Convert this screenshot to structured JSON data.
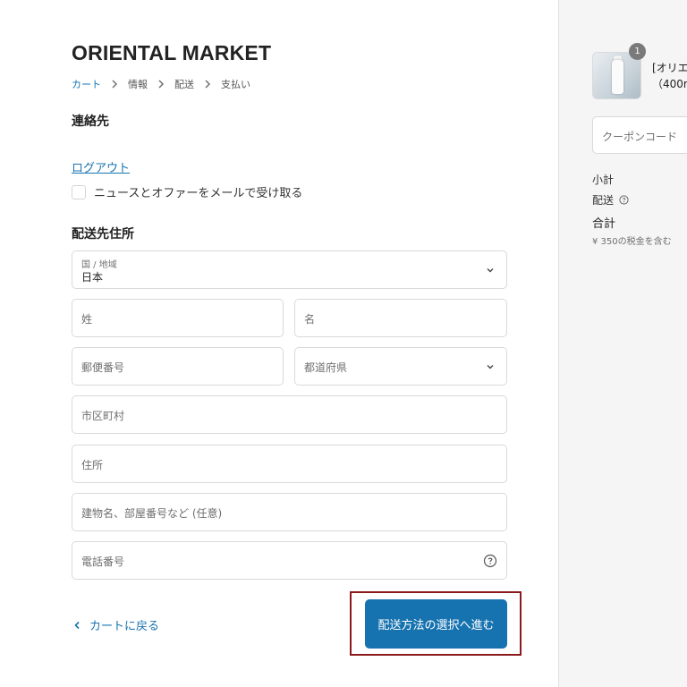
{
  "store": {
    "title": "ORIENTAL MARKET"
  },
  "breadcrumb": {
    "cart": "カート",
    "info": "情報",
    "shipping": "配送",
    "payment": "支払い"
  },
  "contact": {
    "title": "連絡先",
    "logout": "ログアウト",
    "newsletter_label": "ニュースとオファーをメールで受け取る"
  },
  "shipping_address": {
    "title": "配送先住所",
    "country_label": "国 / 地域",
    "country_value": "日本",
    "last_name": "姓",
    "first_name": "名",
    "postal_code": "郵便番号",
    "prefecture": "都道府県",
    "city": "市区町村",
    "address": "住所",
    "building": "建物名、部屋番号など (任意)",
    "phone": "電話番号"
  },
  "footer": {
    "back_label": "カートに戻る",
    "continue_label": "配送方法の選択へ進む"
  },
  "sidebar": {
    "product_qty": "1",
    "product_line1": "[オリエ",
    "product_line2": "（400m",
    "coupon_placeholder": "クーポンコード",
    "subtotal_label": "小計",
    "shipping_label": "配送",
    "total_label": "合計",
    "tax_note": "¥ 350の税金を含む"
  },
  "icons": [
    "chevron-right-icon",
    "chevron-down-icon",
    "help-circle-icon",
    "chevron-left-icon",
    "info-circle-icon"
  ],
  "colors": {
    "link": "#1773b0",
    "button": "#1773b0",
    "highlight": "#8b1a1a",
    "sidebar_bg": "#f5f5f5"
  }
}
